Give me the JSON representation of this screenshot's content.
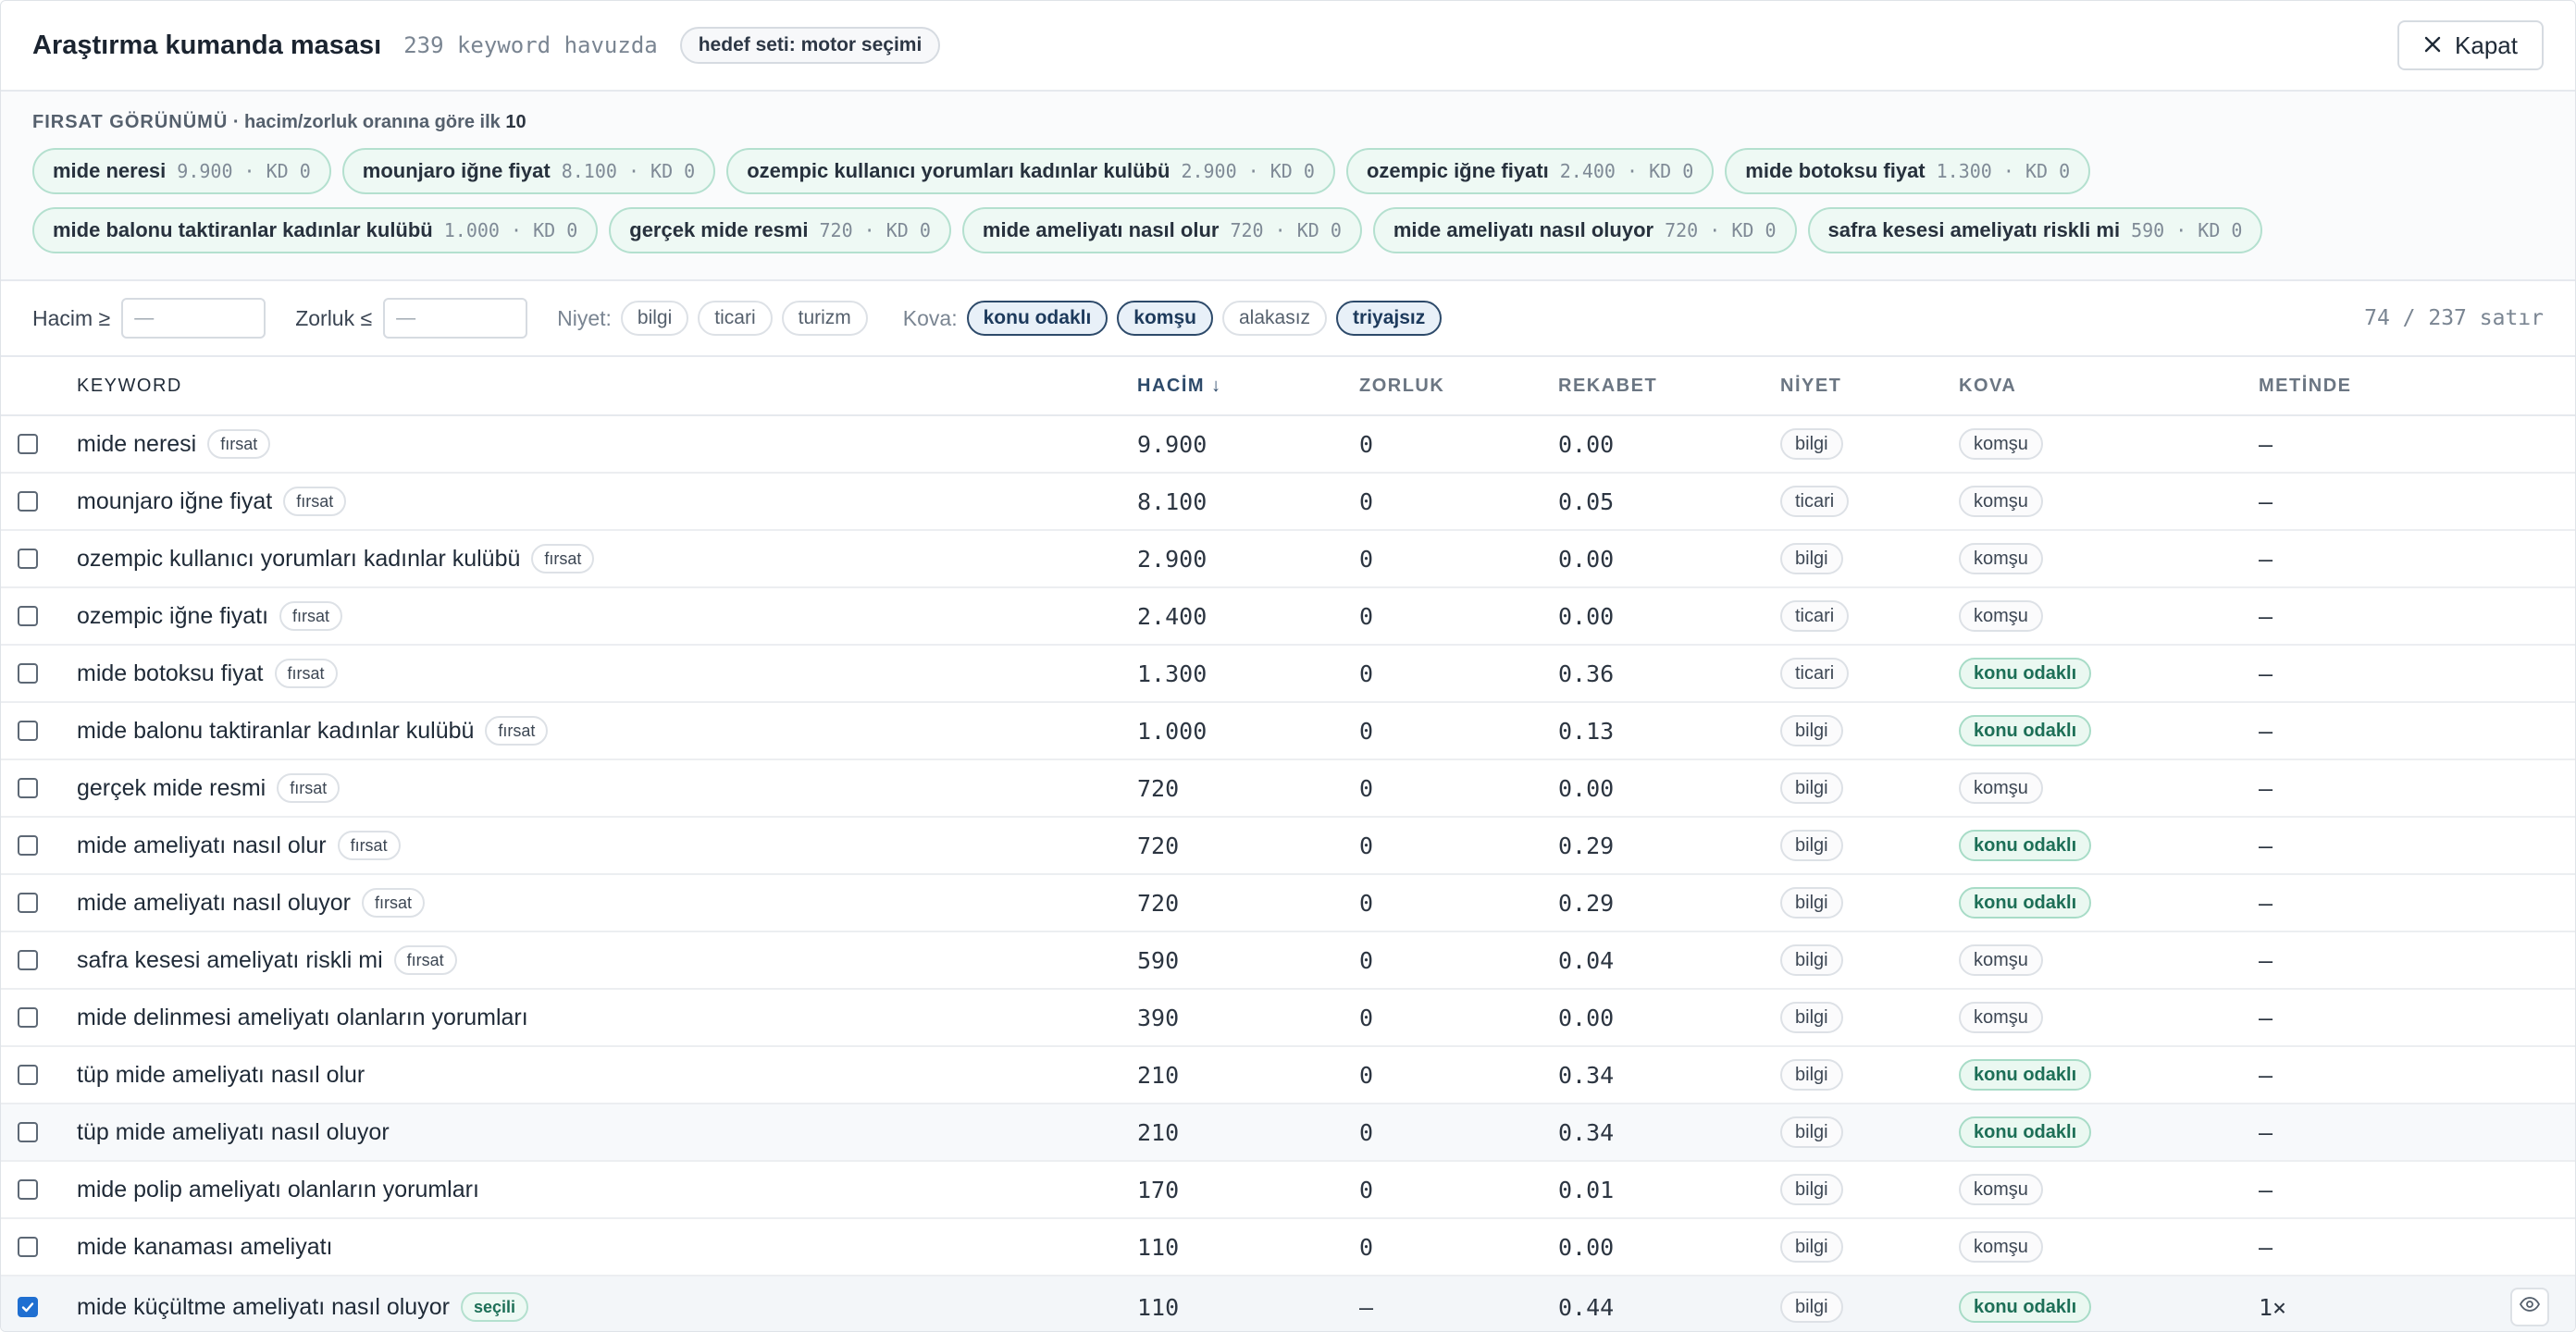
{
  "header": {
    "title": "Araştırma kumanda masası",
    "pool": "239 keyword havuzda",
    "target_set": "hedef seti: motor seçimi",
    "close_label": "Kapat"
  },
  "opportunity": {
    "title": "FIRSAT GÖRÜNÜMÜ",
    "subtitle_prefix": " · hacim/zorluk oranına göre ilk ",
    "subtitle_count": "10",
    "chips": [
      {
        "keyword": "mide neresi",
        "meta": "9.900 · KD 0"
      },
      {
        "keyword": "mounjaro iğne fiyat",
        "meta": "8.100 · KD 0"
      },
      {
        "keyword": "ozempic kullanıcı yorumları kadınlar kulübü",
        "meta": "2.900 · KD 0"
      },
      {
        "keyword": "ozempic iğne fiyatı",
        "meta": "2.400 · KD 0"
      },
      {
        "keyword": "mide botoksu fiyat",
        "meta": "1.300 · KD 0"
      },
      {
        "keyword": "mide balonu taktiranlar kadınlar kulübü",
        "meta": "1.000 · KD 0"
      },
      {
        "keyword": "gerçek mide resmi",
        "meta": "720 · KD 0"
      },
      {
        "keyword": "mide ameliyatı nasıl olur",
        "meta": "720 · KD 0"
      },
      {
        "keyword": "mide ameliyatı nasıl oluyor",
        "meta": "720 · KD 0"
      },
      {
        "keyword": "safra kesesi ameliyatı riskli mi",
        "meta": "590 · KD 0"
      }
    ]
  },
  "filters": {
    "volume_label": "Hacim ≥",
    "volume_placeholder": "—",
    "difficulty_label": "Zorluk ≤",
    "difficulty_placeholder": "—",
    "intent_label": "Niyet:",
    "intent_options": [
      "bilgi",
      "ticari",
      "turizm"
    ],
    "bucket_label": "Kova:",
    "bucket_options": [
      {
        "label": "konu odaklı",
        "active": true
      },
      {
        "label": "komşu",
        "active": true
      },
      {
        "label": "alakasız",
        "active": false
      },
      {
        "label": "triyajsız",
        "active": true
      }
    ],
    "row_count": "74 / 237 satır"
  },
  "table": {
    "columns": {
      "keyword": "KEYWORD",
      "volume": "HACİM ↓",
      "difficulty": "ZORLUK",
      "competition": "REKABET",
      "intent": "NİYET",
      "bucket": "KOVA",
      "in_text": "METİNDE"
    },
    "rows": [
      {
        "keyword": "mide neresi",
        "badge": "fırsat",
        "volume": "9.900",
        "kd": "0",
        "competition": "0.00",
        "intent": "bilgi",
        "bucket": "komşu",
        "in_text": "—"
      },
      {
        "keyword": "mounjaro iğne fiyat",
        "badge": "fırsat",
        "volume": "8.100",
        "kd": "0",
        "competition": "0.05",
        "intent": "ticari",
        "bucket": "komşu",
        "in_text": "—"
      },
      {
        "keyword": "ozempic kullanıcı yorumları kadınlar kulübü",
        "badge": "fırsat",
        "volume": "2.900",
        "kd": "0",
        "competition": "0.00",
        "intent": "bilgi",
        "bucket": "komşu",
        "in_text": "—"
      },
      {
        "keyword": "ozempic iğne fiyatı",
        "badge": "fırsat",
        "volume": "2.400",
        "kd": "0",
        "competition": "0.00",
        "intent": "ticari",
        "bucket": "komşu",
        "in_text": "—"
      },
      {
        "keyword": "mide botoksu fiyat",
        "badge": "fırsat",
        "volume": "1.300",
        "kd": "0",
        "competition": "0.36",
        "intent": "ticari",
        "bucket": "konu odaklı",
        "in_text": "—"
      },
      {
        "keyword": "mide balonu taktiranlar kadınlar kulübü",
        "badge": "fırsat",
        "volume": "1.000",
        "kd": "0",
        "competition": "0.13",
        "intent": "bilgi",
        "bucket": "konu odaklı",
        "in_text": "—"
      },
      {
        "keyword": "gerçek mide resmi",
        "badge": "fırsat",
        "volume": "720",
        "kd": "0",
        "competition": "0.00",
        "intent": "bilgi",
        "bucket": "komşu",
        "in_text": "—"
      },
      {
        "keyword": "mide ameliyatı nasıl olur",
        "badge": "fırsat",
        "volume": "720",
        "kd": "0",
        "competition": "0.29",
        "intent": "bilgi",
        "bucket": "konu odaklı",
        "in_text": "—"
      },
      {
        "keyword": "mide ameliyatı nasıl oluyor",
        "badge": "fırsat",
        "volume": "720",
        "kd": "0",
        "competition": "0.29",
        "intent": "bilgi",
        "bucket": "konu odaklı",
        "in_text": "—"
      },
      {
        "keyword": "safra kesesi ameliyatı riskli mi",
        "badge": "fırsat",
        "volume": "590",
        "kd": "0",
        "competition": "0.04",
        "intent": "bilgi",
        "bucket": "komşu",
        "in_text": "—"
      },
      {
        "keyword": "mide delinmesi ameliyatı olanların yorumları",
        "badge": "",
        "volume": "390",
        "kd": "0",
        "competition": "0.00",
        "intent": "bilgi",
        "bucket": "komşu",
        "in_text": "—"
      },
      {
        "keyword": "tüp mide ameliyatı nasıl olur",
        "badge": "",
        "volume": "210",
        "kd": "0",
        "competition": "0.34",
        "intent": "bilgi",
        "bucket": "konu odaklı",
        "in_text": "—"
      },
      {
        "keyword": "tüp mide ameliyatı nasıl oluyor",
        "badge": "",
        "volume": "210",
        "kd": "0",
        "competition": "0.34",
        "intent": "bilgi",
        "bucket": "konu odaklı",
        "in_text": "—"
      },
      {
        "keyword": "mide polip ameliyatı olanların yorumları",
        "badge": "",
        "volume": "170",
        "kd": "0",
        "competition": "0.01",
        "intent": "bilgi",
        "bucket": "komşu",
        "in_text": "—"
      },
      {
        "keyword": "mide kanaması ameliyatı",
        "badge": "",
        "volume": "110",
        "kd": "0",
        "competition": "0.00",
        "intent": "bilgi",
        "bucket": "komşu",
        "in_text": "—"
      },
      {
        "keyword": "mide küçültme ameliyatı nasıl oluyor",
        "badge": "seçili",
        "volume": "110",
        "kd": "—",
        "competition": "0.44",
        "intent": "bilgi",
        "bucket": "konu odaklı",
        "in_text": "1×",
        "selected": true
      }
    ]
  },
  "colors": {
    "accent": "#2d4a6a",
    "opportunity_green": "#eef9f4",
    "checkbox_blue": "#1f6fd1"
  },
  "icons": {
    "close": "close-icon",
    "eye": "eye-icon",
    "check": "check-icon"
  }
}
